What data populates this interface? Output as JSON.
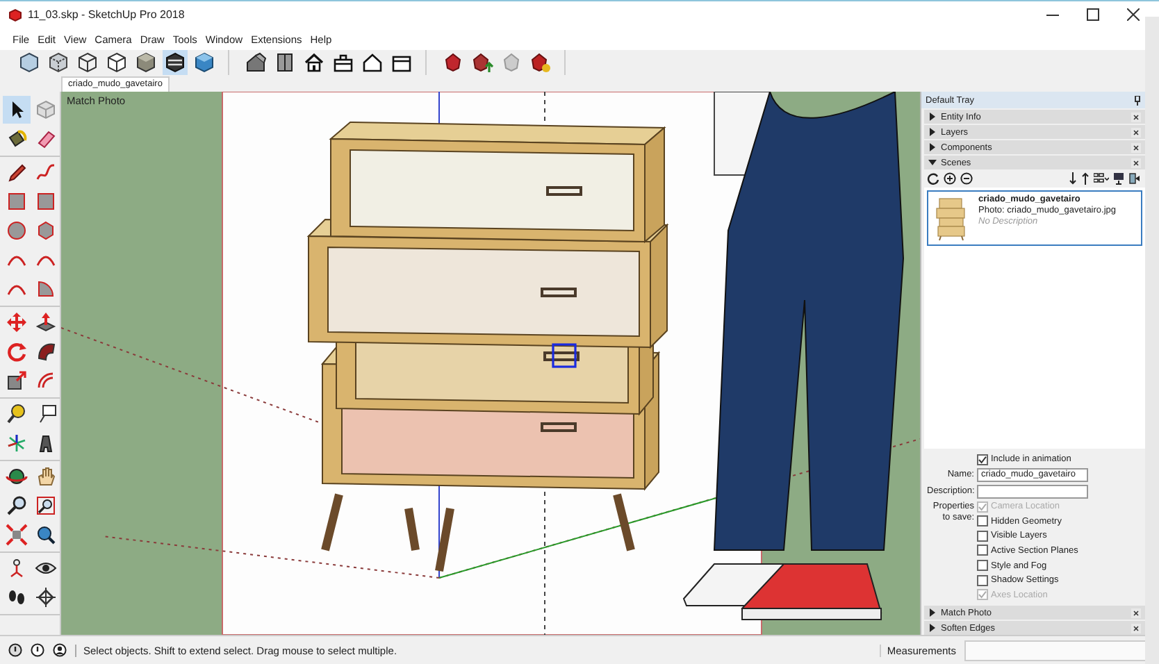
{
  "window": {
    "title": "11_03.skp - SketchUp Pro 2018"
  },
  "menu": [
    "File",
    "Edit",
    "View",
    "Camera",
    "Draw",
    "Tools",
    "Window",
    "Extensions",
    "Help"
  ],
  "toolbar": {
    "groups": [
      [
        {
          "kind": "xray-cube",
          "selected": false
        },
        {
          "kind": "back-cube",
          "selected": false
        },
        {
          "kind": "wire-cube",
          "selected": false
        },
        {
          "kind": "hidden-cube",
          "selected": false
        },
        {
          "kind": "shaded-cube",
          "selected": false
        },
        {
          "kind": "striped-cube",
          "selected": true
        },
        {
          "kind": "mono-cube",
          "selected": false
        }
      ],
      [
        {
          "kind": "iso-house",
          "selected": false
        },
        {
          "kind": "top-panel",
          "selected": false
        },
        {
          "kind": "house",
          "selected": false
        },
        {
          "kind": "side-house",
          "selected": false
        },
        {
          "kind": "outline-house",
          "selected": false
        },
        {
          "kind": "back-house",
          "selected": false
        }
      ],
      [
        {
          "kind": "gem",
          "selected": false
        },
        {
          "kind": "gem-upload",
          "selected": false
        },
        {
          "kind": "gem-faded",
          "selected": false
        },
        {
          "kind": "gem-star",
          "selected": false
        }
      ]
    ]
  },
  "scene_tabs": [
    {
      "label": "criado_mudo_gavetairo",
      "selected": true
    }
  ],
  "tool_groups": [
    [
      {
        "kind": "arrow",
        "selected": true
      },
      {
        "kind": "component",
        "selected": false
      },
      {
        "kind": "bucket",
        "selected": false
      },
      {
        "kind": "eraser",
        "selected": false
      }
    ],
    [
      {
        "kind": "pencil",
        "selected": false
      },
      {
        "kind": "squiggle",
        "selected": false
      },
      {
        "kind": "rectangle",
        "selected": false
      },
      {
        "kind": "rectangle",
        "selected": false
      },
      {
        "kind": "circle",
        "selected": false
      },
      {
        "kind": "polygon",
        "selected": false
      },
      {
        "kind": "arc",
        "selected": false
      },
      {
        "kind": "arc",
        "selected": false
      },
      {
        "kind": "arc",
        "selected": false
      },
      {
        "kind": "pie",
        "selected": false
      }
    ],
    [
      {
        "kind": "move",
        "selected": false
      },
      {
        "kind": "pushpull",
        "selected": false
      },
      {
        "kind": "rotate",
        "selected": false
      },
      {
        "kind": "followme",
        "selected": false
      },
      {
        "kind": "scale",
        "selected": false
      },
      {
        "kind": "offset",
        "selected": false
      }
    ],
    [
      {
        "kind": "tape",
        "selected": false
      },
      {
        "kind": "text",
        "selected": false
      },
      {
        "kind": "axes",
        "selected": false
      },
      {
        "kind": "solid-text",
        "selected": false
      }
    ],
    [
      {
        "kind": "orbit",
        "selected": false
      },
      {
        "kind": "hand",
        "selected": false
      },
      {
        "kind": "zoom",
        "selected": false
      },
      {
        "kind": "zoom-window",
        "selected": false
      },
      {
        "kind": "extents",
        "selected": false
      },
      {
        "kind": "previous",
        "selected": false
      }
    ],
    [
      {
        "kind": "position",
        "selected": false
      },
      {
        "kind": "eye",
        "selected": false
      },
      {
        "kind": "walk",
        "selected": false
      },
      {
        "kind": "section",
        "selected": false
      }
    ]
  ],
  "viewport": {
    "label": "Match Photo"
  },
  "tray": {
    "title": "Default Tray",
    "panels": [
      {
        "label": "Entity Info",
        "expanded": false
      },
      {
        "label": "Layers",
        "expanded": false
      },
      {
        "label": "Components",
        "expanded": false
      },
      {
        "label": "Scenes",
        "expanded": true
      }
    ],
    "scenes": [
      {
        "name": "criado_mudo_gavetairo",
        "photo": "Photo: criado_mudo_gavetairo.jpg",
        "description": "No Description",
        "selected": true
      }
    ],
    "include_label": "Include in animation",
    "include_in_animation": true,
    "name_label": "Name:",
    "name_value": "criado_mudo_gavetairo",
    "description_label": "Description:",
    "properties_label": "Properties to save:",
    "properties": [
      {
        "label": "Camera Location",
        "checked": true,
        "disabled": true
      },
      {
        "label": "Hidden Geometry",
        "checked": false,
        "disabled": false
      },
      {
        "label": "Visible Layers",
        "checked": false,
        "disabled": false
      },
      {
        "label": "Active Section Planes",
        "checked": false,
        "disabled": false
      },
      {
        "label": "Style and Fog",
        "checked": false,
        "disabled": false
      },
      {
        "label": "Shadow Settings",
        "checked": false,
        "disabled": false
      },
      {
        "label": "Axes Location",
        "checked": true,
        "disabled": true
      }
    ],
    "lower_panels": [
      {
        "label": "Match Photo",
        "expanded": false
      },
      {
        "label": "Soften Edges",
        "expanded": false
      }
    ]
  },
  "status_bar": {
    "message": "Select objects. Shift to extend select. Drag mouse to select multiple.",
    "measurements_label": "Measurements"
  }
}
